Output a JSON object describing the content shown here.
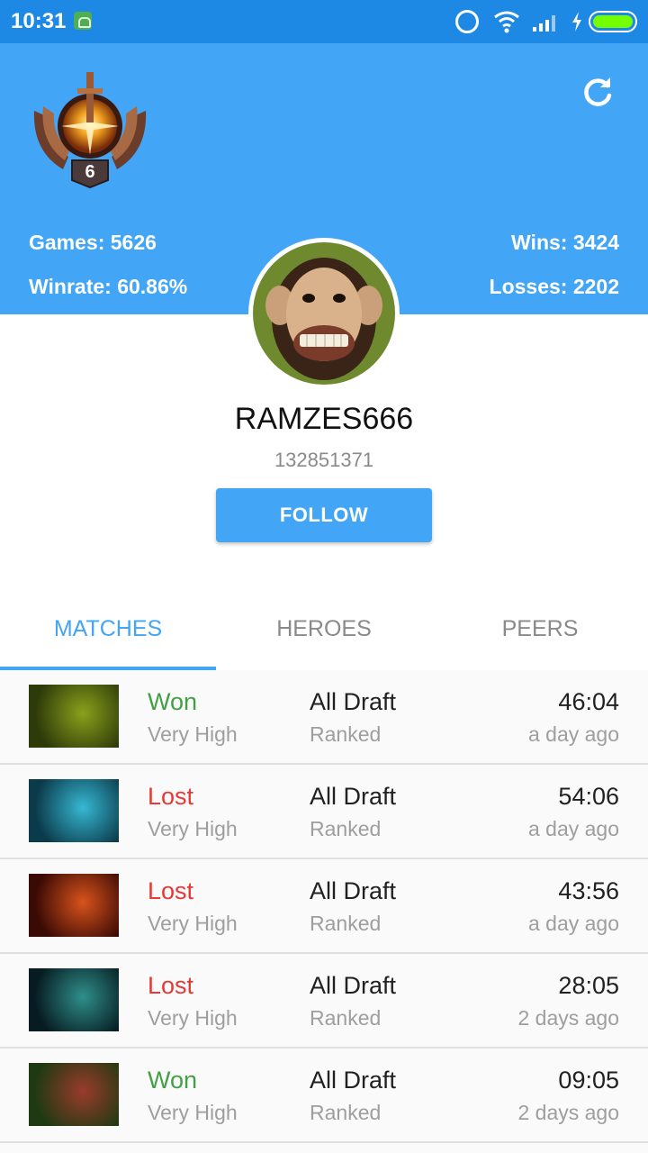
{
  "status_bar": {
    "time": "10:31",
    "icons": [
      "android-icon",
      "alarm-icon",
      "wifi-icon",
      "signal-icon",
      "charge-icon",
      "battery-icon"
    ]
  },
  "header": {
    "rank_number": "6",
    "stats": {
      "games": "Games: 5626",
      "winrate": "Winrate: 60.86%",
      "wins": "Wins: 3424",
      "losses": "Losses: 2202"
    },
    "refresh_icon": "refresh-icon"
  },
  "profile": {
    "username": "RAMZES666",
    "account_id": "132851371",
    "follow_label": "FOLLOW"
  },
  "tabs": [
    {
      "label": "MATCHES",
      "active": true
    },
    {
      "label": "HEROES",
      "active": false
    },
    {
      "label": "PEERS",
      "active": false
    }
  ],
  "matches": [
    {
      "result": "Won",
      "skill": "Very High",
      "mode": "All Draft",
      "lobby": "Ranked",
      "duration": "46:04",
      "when": "a day ago",
      "hero_colors": [
        "#2d3a0a",
        "#8aa11a"
      ]
    },
    {
      "result": "Lost",
      "skill": "Very High",
      "mode": "All Draft",
      "lobby": "Ranked",
      "duration": "54:06",
      "when": "a day ago",
      "hero_colors": [
        "#0b3a4a",
        "#36b8d2"
      ]
    },
    {
      "result": "Lost",
      "skill": "Very High",
      "mode": "All Draft",
      "lobby": "Ranked",
      "duration": "43:56",
      "when": "a day ago",
      "hero_colors": [
        "#3a0a05",
        "#d8531b"
      ]
    },
    {
      "result": "Lost",
      "skill": "Very High",
      "mode": "All Draft",
      "lobby": "Ranked",
      "duration": "28:05",
      "when": "2 days ago",
      "hero_colors": [
        "#071c22",
        "#2f8f8a"
      ]
    },
    {
      "result": "Won",
      "skill": "Very High",
      "mode": "All Draft",
      "lobby": "Ranked",
      "duration": "09:05",
      "when": "2 days ago",
      "hero_colors": [
        "#1f3a12",
        "#9a3b2b"
      ]
    }
  ],
  "colors": {
    "primary": "#42a5f5",
    "status_bar": "#1e88e5",
    "won": "#43a047",
    "lost": "#e53935"
  }
}
